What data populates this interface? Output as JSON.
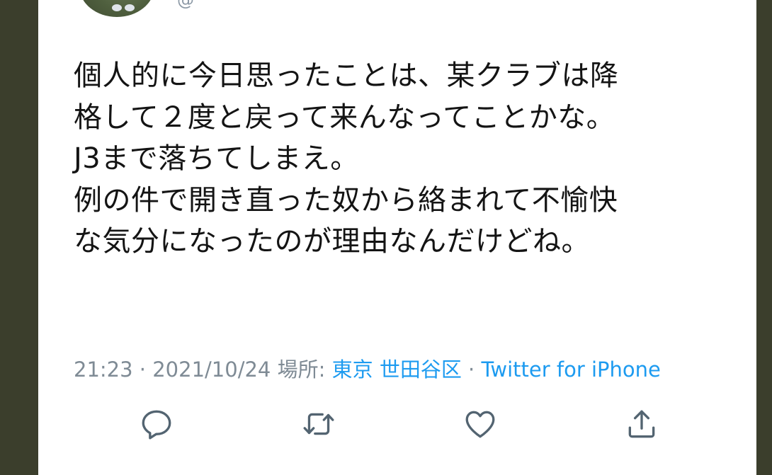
{
  "tweet": {
    "handle": "@",
    "text_lines": [
      "個人的に今日思ったことは、某クラブは降",
      "格して２度と戻って来んなってことかな。",
      "J3まで落ちてしまえ。",
      "例の件で開き直った奴から絡まれて不愉快",
      "な気分になったのが理由なんだけどね。"
    ],
    "meta": {
      "time": "21:23",
      "separator1": " · ",
      "date": "2021/10/24",
      "location_label": " 場所: ",
      "location": "東京 世田谷区",
      "separator2": " · ",
      "client": "Twitter for iPhone"
    }
  },
  "actions": {
    "icons": [
      "reply-icon",
      "retweet-icon",
      "like-icon",
      "share-icon"
    ],
    "icon_color": "#536471"
  }
}
